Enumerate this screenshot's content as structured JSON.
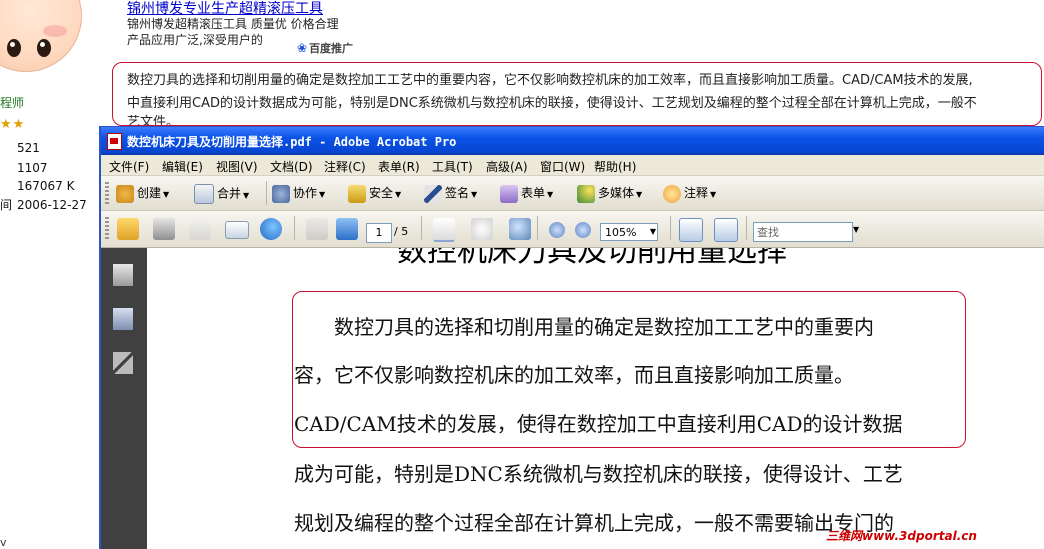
{
  "web": {
    "user_rank": "程师",
    "stars": "★★",
    "stats": [
      "521",
      "1107",
      "167067 K",
      "2006-12-27"
    ],
    "stat_cut_label": "间",
    "ad": {
      "title": "锦州博发专业生产超精滚压工具",
      "line1": "锦州博发超精滚压工具 质量优 价格合理",
      "line2": "产品应用广泛,深受用户的",
      "baidu": "百度推广"
    },
    "quote_lines": [
      "数控刀具的选择和切削用量的确定是数控加工工艺中的重要内容，它不仅影响数控机床的加工效率，而且直接影响加工质量。CAD/CAM技术的发展,",
      "中直接利用CAD的设计数据成为可能，特别是DNC系统微机与数控机床的联接，使得设计、工艺规划及编程的整个过程全部在计算机上完成，一般不",
      "艺文件。"
    ],
    "watermark": "三维网www.3dportal.cn",
    "corner_text": "v"
  },
  "acrobat": {
    "title": "数控机床刀具及切削用量选择.pdf - Adobe Acrobat Pro",
    "menu": [
      "文件(F)",
      "编辑(E)",
      "视图(V)",
      "文档(D)",
      "注释(C)",
      "表单(R)",
      "工具(T)",
      "高级(A)",
      "窗口(W)",
      "帮助(H)"
    ],
    "tasks": [
      "创建",
      "合并",
      "协作",
      "安全",
      "签名",
      "表单",
      "多媒体",
      "注释"
    ],
    "page_current": "1",
    "page_total": "/ 5",
    "zoom": "105%",
    "find_placeholder": "查找",
    "doc_title": "数控机床刀具及切削用量选择",
    "doc_lines": [
      "　　数控刀具的选择和切削用量的确定是数控加工工艺中的重要内",
      "容，它不仅影响数控机床的加工效率，而且直接影响加工质量。",
      "CAD/CAM技术的发展，使得在数控加工中直接利用CAD的设计数据",
      "成为可能，特别是DNC系统微机与数控机床的联接，使得设计、工艺",
      "规划及编程的整个过程全部在计算机上完成，一般不需要输出专门的"
    ]
  }
}
